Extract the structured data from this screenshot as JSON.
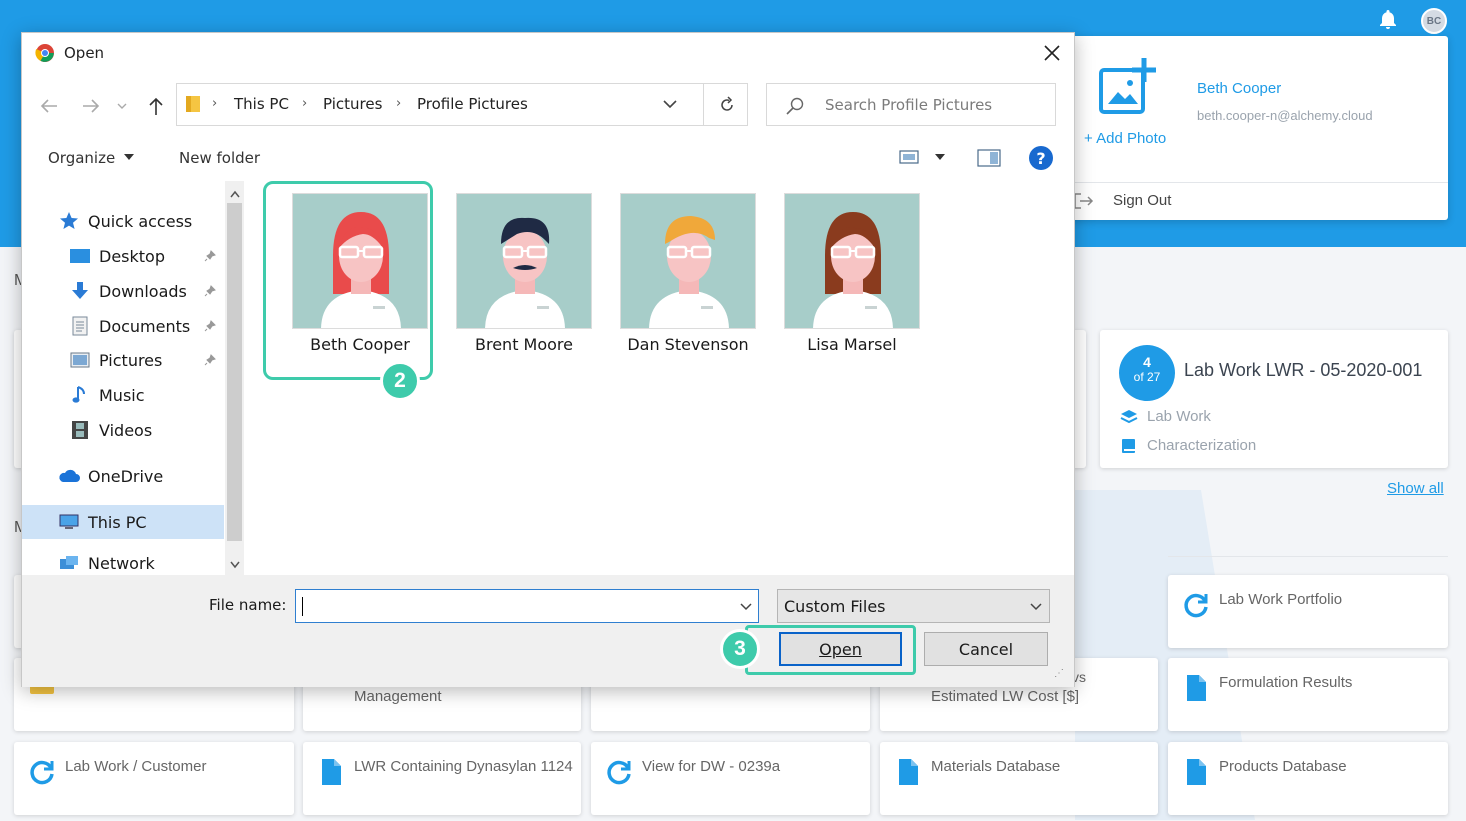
{
  "dialog": {
    "title": "Open",
    "address": [
      "This PC",
      "Pictures",
      "Profile Pictures"
    ],
    "search_placeholder": "Search Profile Pictures",
    "toolbar": {
      "organize": "Organize",
      "new_folder": "New folder",
      "help": "?"
    },
    "nav": {
      "items": [
        {
          "label": "Quick access"
        },
        {
          "label": "Desktop"
        },
        {
          "label": "Downloads"
        },
        {
          "label": "Documents"
        },
        {
          "label": "Pictures"
        },
        {
          "label": "Music"
        },
        {
          "label": "Videos"
        },
        {
          "label": "OneDrive"
        },
        {
          "label": "This PC"
        },
        {
          "label": "Network"
        }
      ]
    },
    "files": [
      {
        "name": "Beth Cooper",
        "hair": "#e94b4b",
        "selected": true
      },
      {
        "name": "Brent Moore",
        "hair": "#1f2a44"
      },
      {
        "name": "Dan Stevenson",
        "hair": "#f0a83a"
      },
      {
        "name": "Lisa Marsel",
        "hair": "#8a3b1e"
      }
    ],
    "file_name_label": "File name:",
    "file_name_value": "",
    "file_type": "Custom Files",
    "open_label": "Open",
    "cancel_label": "Cancel",
    "steps": {
      "select_file": "2",
      "click_open": "3"
    }
  },
  "profile": {
    "name": "Beth  Cooper",
    "email": "beth.cooper-n@alchemy.cloud",
    "add_photo": "+ Add Photo",
    "sign_out": "Sign Out",
    "avatar_initials": "BC"
  },
  "lab_card": {
    "count": "4",
    "of": "of 27",
    "title": "Lab Work LWR - 05-2020-001",
    "type": "Lab Work",
    "category": "Characterization"
  },
  "show_all": "Show all",
  "cut_letters": [
    "M",
    "M"
  ],
  "tiles": [
    {
      "label": "Lab Work Portfolio",
      "icon": "refresh-icon"
    },
    {
      "label": "Formulation Results",
      "icon": "document-icon"
    },
    {
      "label": "Lab Work / Customer",
      "icon": "refresh-icon"
    },
    {
      "label": "LWR Containing Dynasylan 1124",
      "icon": "document-icon"
    },
    {
      "label": "View for DW - 0239a",
      "icon": "refresh-icon"
    },
    {
      "label": "Materials Database",
      "icon": "document-icon"
    },
    {
      "label": "Products Database",
      "icon": "document-icon"
    },
    {
      "label": "Management",
      "icon": "refresh-icon"
    },
    {
      "label": "Estimated LW Cost [$]",
      "icon": "refresh-icon"
    },
    {
      "label": "vs",
      "icon": ""
    }
  ],
  "colors": {
    "accent": "#1f9be6",
    "highlight": "#3ecbab",
    "thumb_bg": "#a7cdc9"
  }
}
